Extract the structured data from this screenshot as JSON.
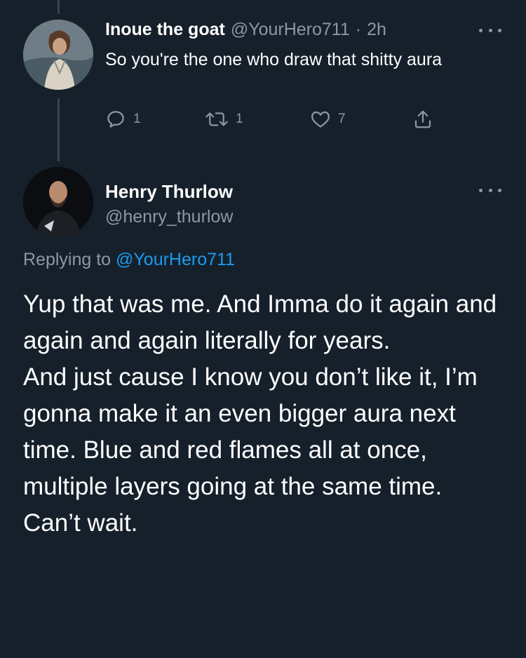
{
  "tweet1": {
    "display_name": "Inoue the goat",
    "handle": "@YourHero711",
    "separator": "·",
    "time": "2h",
    "text": "So you're the one who draw that shitty aura",
    "reply_count": "1",
    "retweet_count": "1",
    "like_count": "7"
  },
  "tweet2": {
    "display_name": "Henry Thurlow",
    "handle": "@henry_thurlow",
    "replying_prefix": "Replying to",
    "replying_to": "@YourHero711",
    "paragraphs": [
      "Yup that was me. And Imma do it again and again and again literally for years.",
      "And just cause I know you don’t like it, I’m gonna make it an even bigger aura next time. Blue and red flames all at once, multiple layers going at the same time.",
      "Can’t wait."
    ]
  },
  "icons": {
    "more": "more-horizontal-icon",
    "reply": "reply-icon",
    "retweet": "retweet-icon",
    "like": "heart-icon",
    "share": "share-icon"
  },
  "colors": {
    "background": "#15202b",
    "text": "#ffffff",
    "secondary": "#8b98a5",
    "link": "#1d9bf0",
    "thread_line": "#38444d"
  }
}
